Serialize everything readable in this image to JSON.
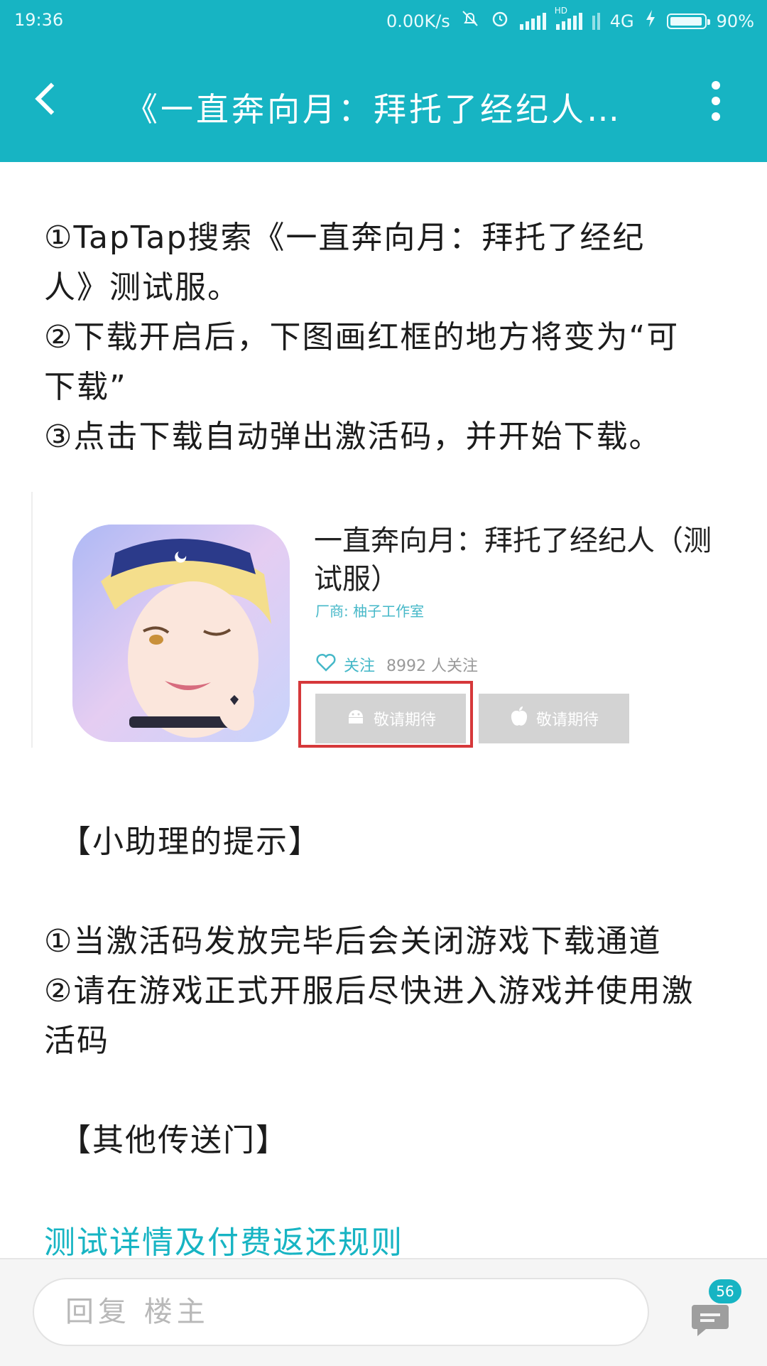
{
  "status_bar": {
    "time": "19:36",
    "net_speed": "0.00K/s",
    "network_type": "4G",
    "hd_label": "HD",
    "battery": "90%"
  },
  "app_bar": {
    "title": "《一直奔向月：拜托了经纪人…"
  },
  "intro": {
    "lines": [
      "①TapTap搜索《一直奔向月：拜托了经纪",
      "人》测试服。",
      "②下载开启后，下图画红框的地方将变为“可",
      "下载”",
      "③点击下载自动弹出激活码，并开始下载。"
    ]
  },
  "game_card": {
    "title": "一直奔向月：拜托了经纪人（测试服）",
    "vendor": "厂商: 柚子工作室",
    "follow_label": "关注",
    "follow_count": "8992 人关注",
    "android_button": "敬请期待",
    "ios_button": "敬请期待"
  },
  "tips": {
    "title": "【小助理的提示】",
    "lines": [
      "①当激活码发放完毕后会关闭游戏下载通道",
      "②请在游戏正式开服后尽快进入游戏并使用激",
      "活码"
    ]
  },
  "portal": {
    "title": "【其他传送门】",
    "link": "测试详情及付费返还规则"
  },
  "bottom_bar": {
    "reply_placeholder": "回复  楼主",
    "comment_count": "56"
  },
  "colors": {
    "accent": "#17b4c3",
    "highlight_box": "#d6383a",
    "button_gray": "#d3d3d3"
  }
}
